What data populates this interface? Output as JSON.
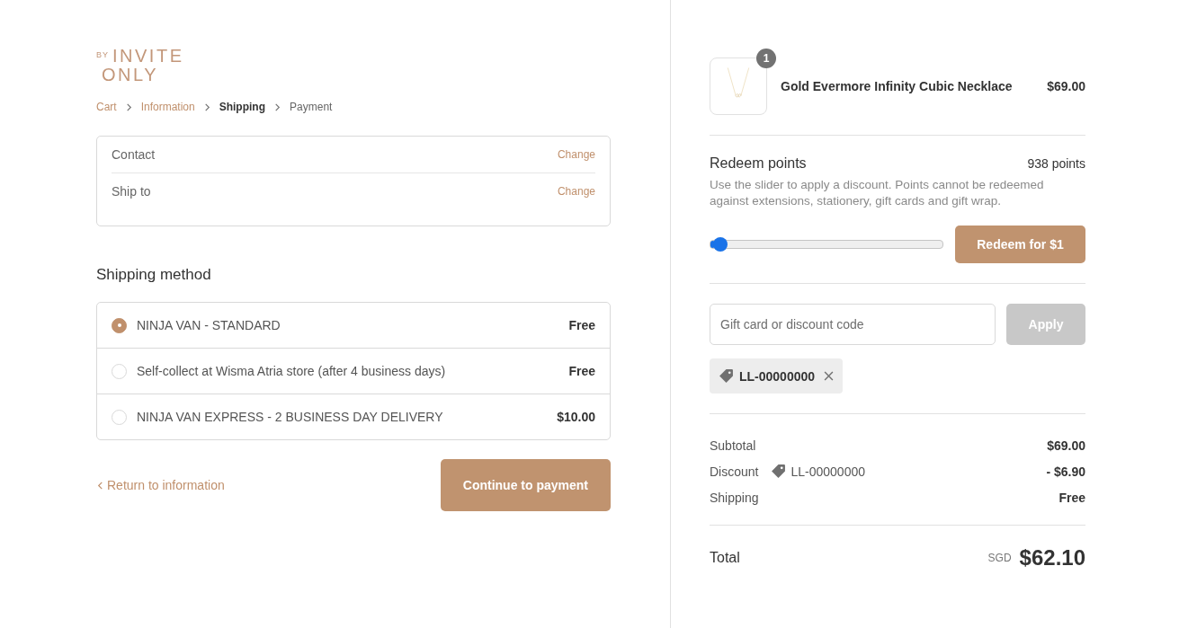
{
  "logo": {
    "prefix": "BY",
    "lines": [
      "INVITE",
      "ONLY"
    ]
  },
  "breadcrumbs": [
    {
      "label": "Cart",
      "selected": false,
      "done": true
    },
    {
      "label": "Information",
      "selected": false,
      "done": true
    },
    {
      "label": "Shipping",
      "selected": true,
      "done": false
    },
    {
      "label": "Payment",
      "selected": false,
      "done": false
    }
  ],
  "review": [
    {
      "label": "Contact",
      "action": "Change"
    },
    {
      "label": "Ship to",
      "action": "Change"
    }
  ],
  "shipping_method": {
    "title": "Shipping method",
    "options": [
      {
        "label": "NINJA VAN - STANDARD",
        "price": "Free",
        "selected": true
      },
      {
        "label": "Self-collect at Wisma Atria store (after 4 business days)",
        "price": "Free",
        "selected": false
      },
      {
        "label": "NINJA VAN EXPRESS - 2 BUSINESS DAY DELIVERY",
        "price": "$10.00",
        "selected": false
      }
    ]
  },
  "return_link": "Return to information",
  "continue_button": "Continue to payment",
  "product": {
    "name": "Gold Evermore Infinity Cubic Necklace",
    "price": "$69.00",
    "quantity": "1"
  },
  "points": {
    "title": "Redeem points",
    "balance": "938 points",
    "note": "Use the slider to apply a discount. Points cannot be redeemed against extensions, stationery, gift cards and gift wrap.",
    "level": 0.02,
    "button": "Redeem for $1"
  },
  "discount": {
    "placeholder": "Gift card or discount code",
    "button": "Apply",
    "button_disabled": true,
    "tag": "LL-00000000"
  },
  "summary": [
    {
      "label": "Subtotal",
      "value": "$69.00"
    },
    {
      "label": "Discount",
      "code": "LL-00000000",
      "value": "- $6.90"
    },
    {
      "label": "Shipping",
      "value": "Free"
    }
  ],
  "total": {
    "label": "Total",
    "currency": "SGD",
    "value": "$62.10"
  }
}
